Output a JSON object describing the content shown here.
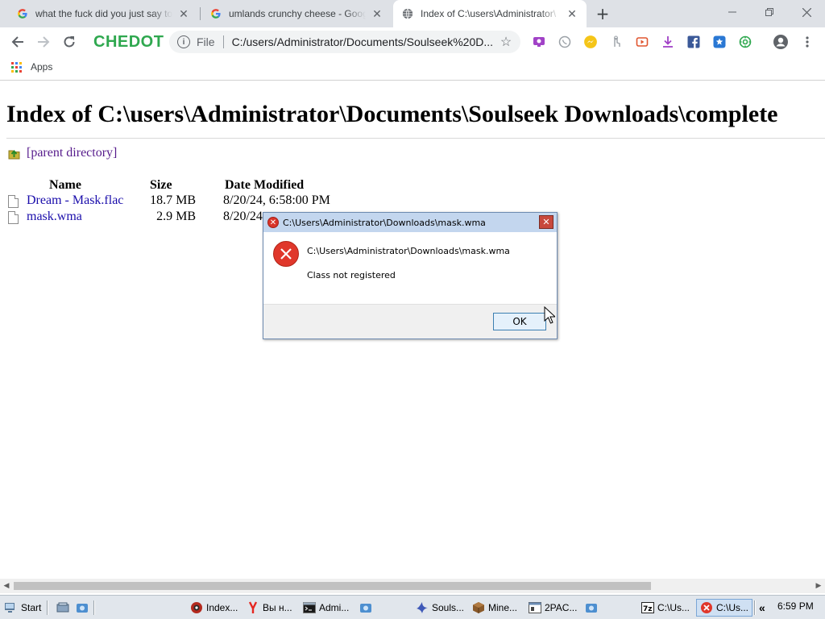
{
  "browser": {
    "tabs": [
      {
        "title": "what the fuck did you just say to",
        "active": false,
        "icon": "google-icon"
      },
      {
        "title": "umlands crunchy cheese - Googl",
        "active": false,
        "icon": "google-icon"
      },
      {
        "title": "Index of C:\\users\\Administrator\\",
        "active": true,
        "icon": "globe-icon"
      }
    ],
    "logo": "CHEDOT",
    "address": {
      "scheme": "File",
      "url": "C:/users/Administrator/Documents/Soulseek%20D..."
    },
    "bookmarks": {
      "apps_label": "Apps"
    },
    "extensions": [
      "screen-icon",
      "whatsapp-icon",
      "messenger-icon",
      "touch-icon",
      "video-icon",
      "download-icon",
      "facebook-icon",
      "vk-icon",
      "puzzle-icon"
    ]
  },
  "page": {
    "heading": "Index of C:\\users\\Administrator\\Documents\\Soulseek Downloads\\complete",
    "parent_link": "[parent directory]",
    "columns": {
      "name": "Name",
      "size": "Size",
      "date": "Date Modified"
    },
    "files": [
      {
        "name": "Dream - Mask.flac",
        "size": "18.7 MB",
        "date": "8/20/24, 6:58:00 PM"
      },
      {
        "name": "mask.wma",
        "size": "2.9 MB",
        "date": "8/20/24,"
      }
    ]
  },
  "dialog": {
    "title": "C:\\Users\\Administrator\\Downloads\\mask.wma",
    "path": "C:\\Users\\Administrator\\Downloads\\mask.wma",
    "message": "Class not registered",
    "ok_label": "OK"
  },
  "taskbar": {
    "start_label": "Start",
    "items": [
      {
        "label": "Index...",
        "icon": "chedot-icon",
        "pressed": false
      },
      {
        "label": "Вы н...",
        "icon": "yandex-icon",
        "pressed": false
      },
      {
        "label": "Admi...",
        "icon": "cmd-icon",
        "pressed": false
      },
      {
        "label": "Souls...",
        "icon": "soulseek-icon",
        "pressed": false
      },
      {
        "label": "Mine...",
        "icon": "minecraft-icon",
        "pressed": false
      },
      {
        "label": "2PAC...",
        "icon": "window-icon",
        "pressed": false
      },
      {
        "label": "C:\\Us...",
        "icon": "7zip-icon",
        "pressed": false
      },
      {
        "label": "C:\\Us...",
        "icon": "error-icon",
        "pressed": true
      }
    ],
    "clock": "6:59 PM"
  },
  "colors": {
    "tabstrip": "#dee1e6",
    "link": "#1a0dab",
    "visited_link": "#551a8b",
    "logo": "#2fa84f",
    "error_red": "#e0372b",
    "dialog_title": "#c3d6ee",
    "taskbar": "#e1e6ec"
  }
}
